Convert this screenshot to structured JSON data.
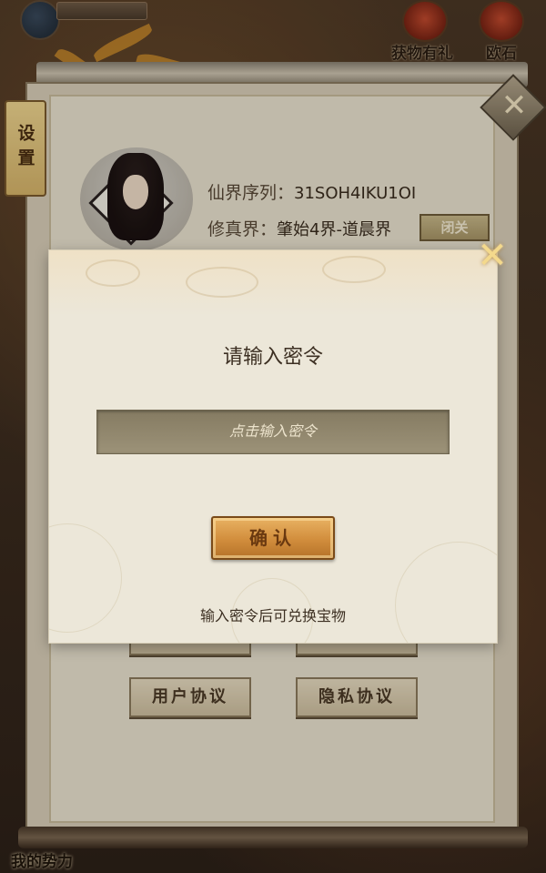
{
  "hud": {
    "badge_text": "",
    "gift_label": "获物有礼",
    "second_label": "欧石"
  },
  "side_tab_label": "设置",
  "profile": {
    "realm_seq_label": "仙界序列：",
    "realm_seq_value": "31SOH4IKU1OI",
    "server_label": "修真界：",
    "server_value": "肇始4界-道晨界",
    "close_server_button": "闭关"
  },
  "panel_buttons": {
    "user_agreement": "用户协议",
    "privacy_agreement": "隐私协议"
  },
  "bottom_label": "我的势力",
  "modal": {
    "title": "请输入密令",
    "input_placeholder": "点击输入密令",
    "input_value": "",
    "confirm_label": "确认",
    "hint": "输入密令后可兑换宝物"
  },
  "icons": {
    "modal_close": "close-icon",
    "panel_close": "close-icon"
  }
}
